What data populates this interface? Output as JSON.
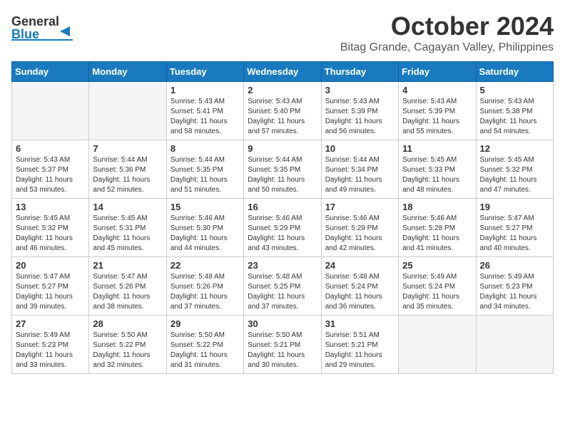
{
  "header": {
    "logo_general": "General",
    "logo_blue": "Blue",
    "title": "October 2024",
    "subtitle": "Bitag Grande, Cagayan Valley, Philippines"
  },
  "calendar": {
    "days_of_week": [
      "Sunday",
      "Monday",
      "Tuesday",
      "Wednesday",
      "Thursday",
      "Friday",
      "Saturday"
    ],
    "weeks": [
      [
        {
          "day": "",
          "info": ""
        },
        {
          "day": "",
          "info": ""
        },
        {
          "day": "1",
          "info": "Sunrise: 5:43 AM\nSunset: 5:41 PM\nDaylight: 11 hours and 58 minutes."
        },
        {
          "day": "2",
          "info": "Sunrise: 5:43 AM\nSunset: 5:40 PM\nDaylight: 11 hours and 57 minutes."
        },
        {
          "day": "3",
          "info": "Sunrise: 5:43 AM\nSunset: 5:39 PM\nDaylight: 11 hours and 56 minutes."
        },
        {
          "day": "4",
          "info": "Sunrise: 5:43 AM\nSunset: 5:39 PM\nDaylight: 11 hours and 55 minutes."
        },
        {
          "day": "5",
          "info": "Sunrise: 5:43 AM\nSunset: 5:38 PM\nDaylight: 11 hours and 54 minutes."
        }
      ],
      [
        {
          "day": "6",
          "info": "Sunrise: 5:43 AM\nSunset: 5:37 PM\nDaylight: 11 hours and 53 minutes."
        },
        {
          "day": "7",
          "info": "Sunrise: 5:44 AM\nSunset: 5:36 PM\nDaylight: 11 hours and 52 minutes."
        },
        {
          "day": "8",
          "info": "Sunrise: 5:44 AM\nSunset: 5:35 PM\nDaylight: 11 hours and 51 minutes."
        },
        {
          "day": "9",
          "info": "Sunrise: 5:44 AM\nSunset: 5:35 PM\nDaylight: 11 hours and 50 minutes."
        },
        {
          "day": "10",
          "info": "Sunrise: 5:44 AM\nSunset: 5:34 PM\nDaylight: 11 hours and 49 minutes."
        },
        {
          "day": "11",
          "info": "Sunrise: 5:45 AM\nSunset: 5:33 PM\nDaylight: 11 hours and 48 minutes."
        },
        {
          "day": "12",
          "info": "Sunrise: 5:45 AM\nSunset: 5:32 PM\nDaylight: 11 hours and 47 minutes."
        }
      ],
      [
        {
          "day": "13",
          "info": "Sunrise: 5:45 AM\nSunset: 5:32 PM\nDaylight: 11 hours and 46 minutes."
        },
        {
          "day": "14",
          "info": "Sunrise: 5:45 AM\nSunset: 5:31 PM\nDaylight: 11 hours and 45 minutes."
        },
        {
          "day": "15",
          "info": "Sunrise: 5:46 AM\nSunset: 5:30 PM\nDaylight: 11 hours and 44 minutes."
        },
        {
          "day": "16",
          "info": "Sunrise: 5:46 AM\nSunset: 5:29 PM\nDaylight: 11 hours and 43 minutes."
        },
        {
          "day": "17",
          "info": "Sunrise: 5:46 AM\nSunset: 5:29 PM\nDaylight: 11 hours and 42 minutes."
        },
        {
          "day": "18",
          "info": "Sunrise: 5:46 AM\nSunset: 5:28 PM\nDaylight: 11 hours and 41 minutes."
        },
        {
          "day": "19",
          "info": "Sunrise: 5:47 AM\nSunset: 5:27 PM\nDaylight: 11 hours and 40 minutes."
        }
      ],
      [
        {
          "day": "20",
          "info": "Sunrise: 5:47 AM\nSunset: 5:27 PM\nDaylight: 11 hours and 39 minutes."
        },
        {
          "day": "21",
          "info": "Sunrise: 5:47 AM\nSunset: 5:26 PM\nDaylight: 11 hours and 38 minutes."
        },
        {
          "day": "22",
          "info": "Sunrise: 5:48 AM\nSunset: 5:26 PM\nDaylight: 11 hours and 37 minutes."
        },
        {
          "day": "23",
          "info": "Sunrise: 5:48 AM\nSunset: 5:25 PM\nDaylight: 11 hours and 37 minutes."
        },
        {
          "day": "24",
          "info": "Sunrise: 5:48 AM\nSunset: 5:24 PM\nDaylight: 11 hours and 36 minutes."
        },
        {
          "day": "25",
          "info": "Sunrise: 5:49 AM\nSunset: 5:24 PM\nDaylight: 11 hours and 35 minutes."
        },
        {
          "day": "26",
          "info": "Sunrise: 5:49 AM\nSunset: 5:23 PM\nDaylight: 11 hours and 34 minutes."
        }
      ],
      [
        {
          "day": "27",
          "info": "Sunrise: 5:49 AM\nSunset: 5:23 PM\nDaylight: 11 hours and 33 minutes."
        },
        {
          "day": "28",
          "info": "Sunrise: 5:50 AM\nSunset: 5:22 PM\nDaylight: 11 hours and 32 minutes."
        },
        {
          "day": "29",
          "info": "Sunrise: 5:50 AM\nSunset: 5:22 PM\nDaylight: 11 hours and 31 minutes."
        },
        {
          "day": "30",
          "info": "Sunrise: 5:50 AM\nSunset: 5:21 PM\nDaylight: 11 hours and 30 minutes."
        },
        {
          "day": "31",
          "info": "Sunrise: 5:51 AM\nSunset: 5:21 PM\nDaylight: 11 hours and 29 minutes."
        },
        {
          "day": "",
          "info": ""
        },
        {
          "day": "",
          "info": ""
        }
      ]
    ]
  }
}
